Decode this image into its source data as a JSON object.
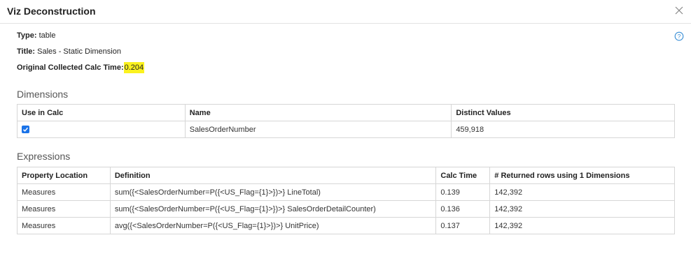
{
  "dialog": {
    "title": "Viz Deconstruction",
    "close_icon": "close-icon",
    "help_icon": "help-circle-icon"
  },
  "info": {
    "type_label": "Type:",
    "type_value": "table",
    "title_label": "Title:",
    "title_value": "Sales - Static Dimension",
    "calc_label": "Original Collected Calc Time:",
    "calc_value": "0.204",
    "highlight_color": "#fbf21f"
  },
  "dimensions": {
    "heading": "Dimensions",
    "columns": [
      "Use in Calc",
      "Name",
      "Distinct Values"
    ],
    "rows": [
      {
        "use_in_calc": true,
        "name": "SalesOrderNumber",
        "distinct": "459,918"
      }
    ],
    "checkbox_color": "#1a73e8"
  },
  "expressions": {
    "heading": "Expressions",
    "columns": [
      "Property Location",
      "Definition",
      "Calc Time",
      "# Returned rows using 1 Dimensions"
    ],
    "rows": [
      {
        "location": "Measures",
        "definition": "sum({<SalesOrderNumber=P({<US_Flag={1}>})>} LineTotal)",
        "calc_time": "0.139",
        "returned_rows": "142,392"
      },
      {
        "location": "Measures",
        "definition": "sum({<SalesOrderNumber=P({<US_Flag={1}>})>} SalesOrderDetailCounter)",
        "calc_time": "0.136",
        "returned_rows": "142,392"
      },
      {
        "location": "Measures",
        "definition": "avg({<SalesOrderNumber=P({<US_Flag={1}>})>} UnitPrice)",
        "calc_time": "0.137",
        "returned_rows": "142,392"
      }
    ]
  }
}
